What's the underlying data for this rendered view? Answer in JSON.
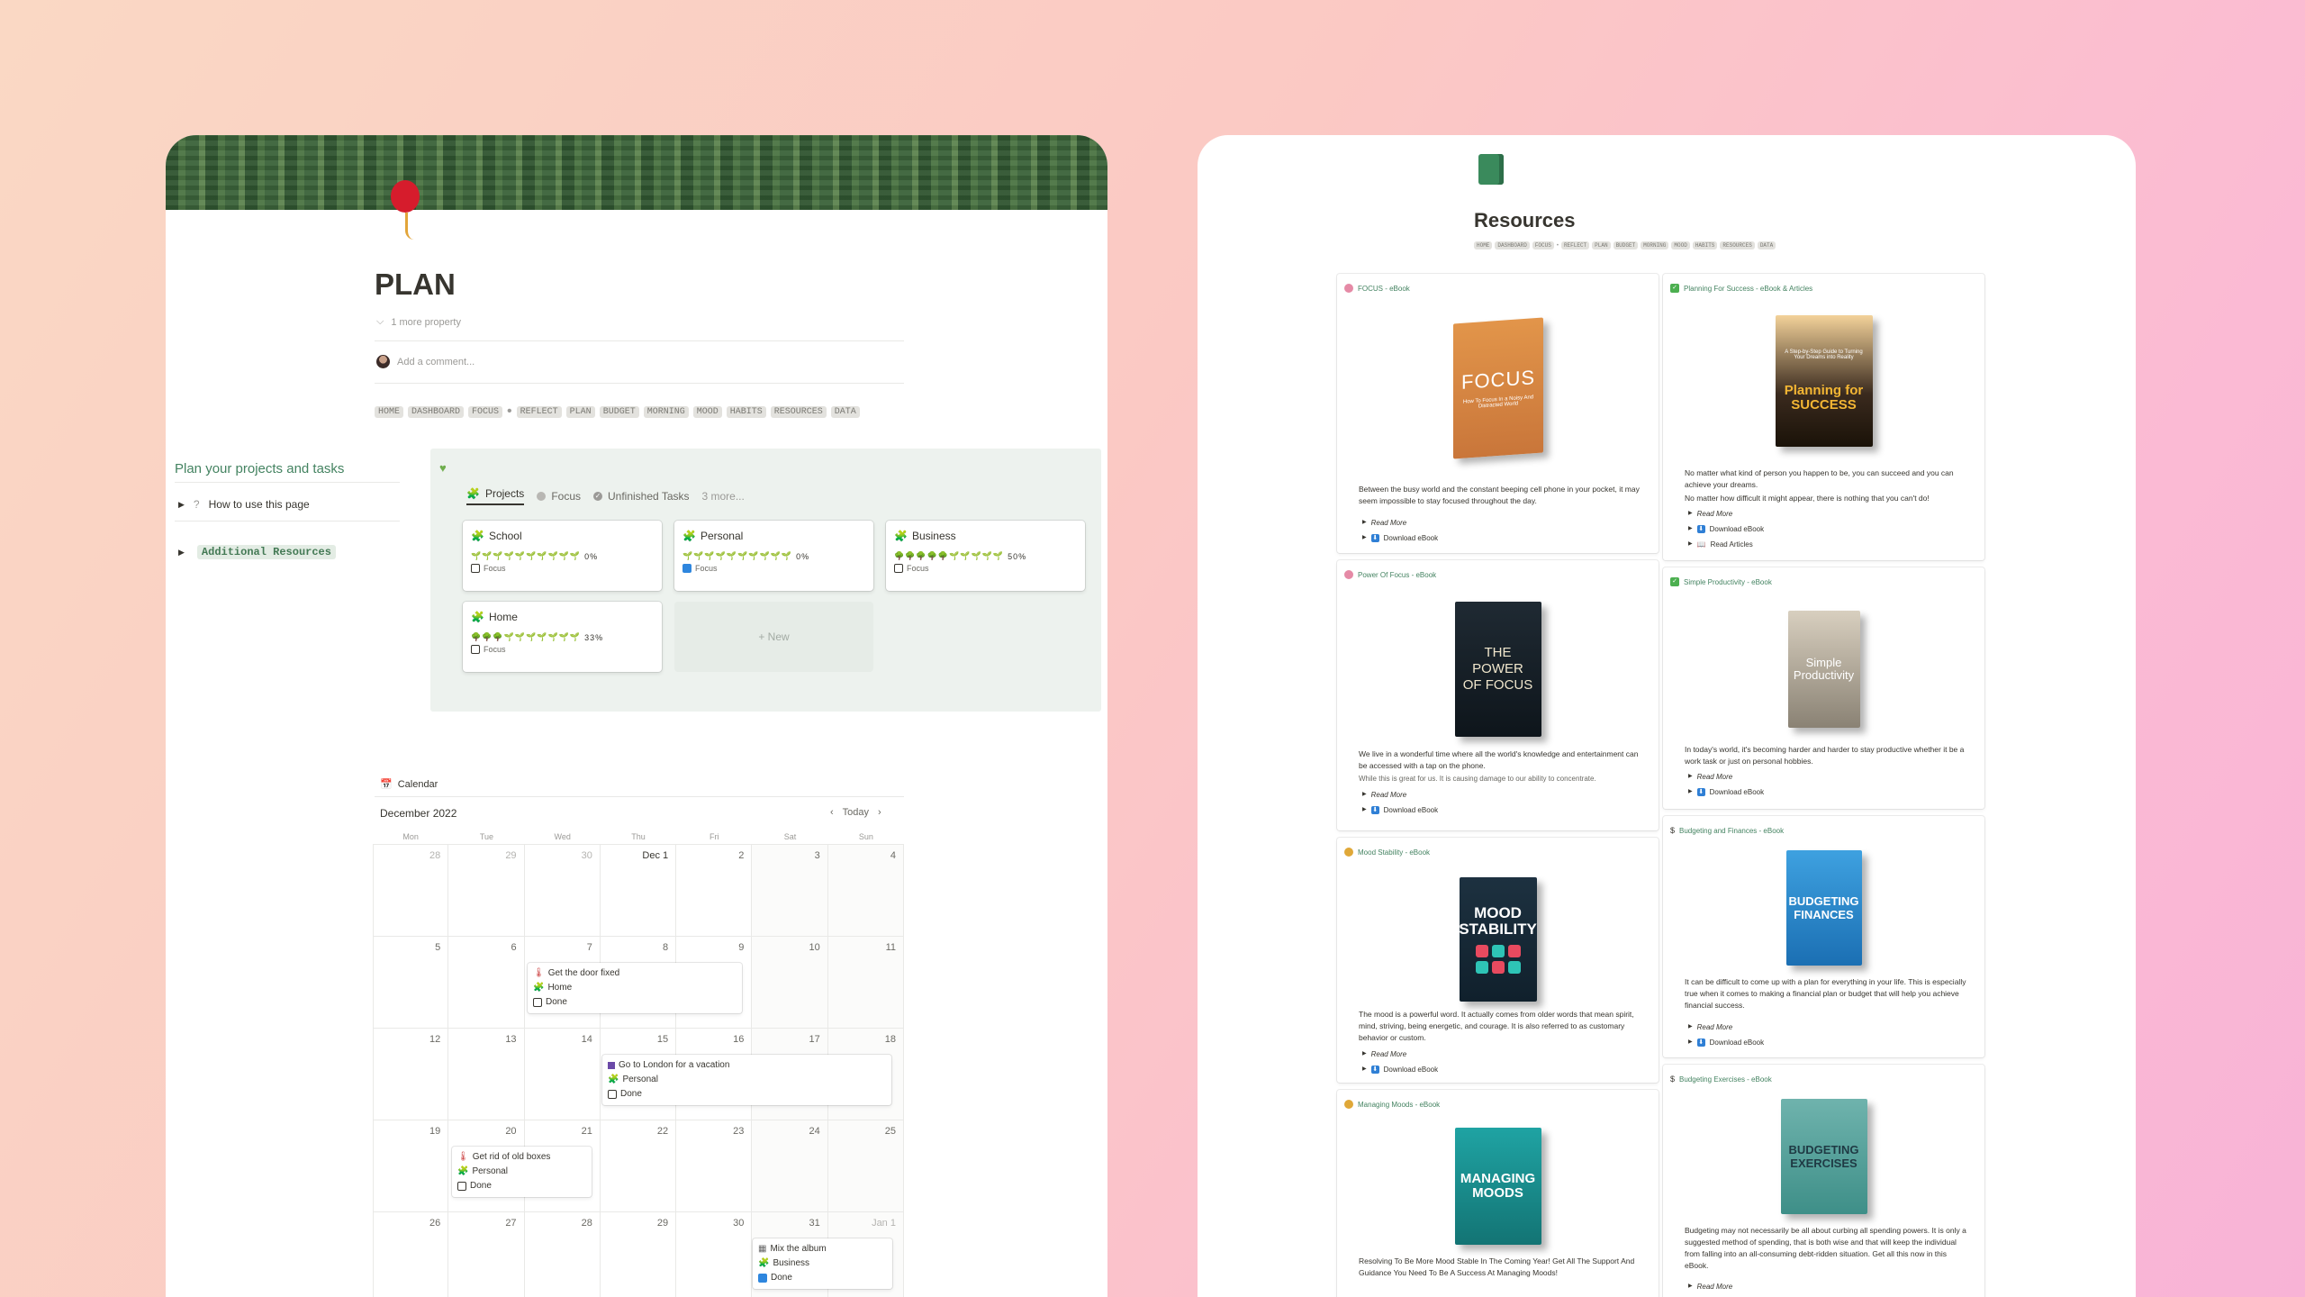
{
  "plan": {
    "title": "PLAN",
    "more_property": "1 more property",
    "comment_placeholder": "Add a comment...",
    "nav": [
      "HOME",
      "DASHBOARD",
      "FOCUS",
      "REFLECT",
      "PLAN",
      "BUDGET",
      "MORNING",
      "MOOD",
      "HABITS",
      "RESOURCES",
      "DATA"
    ],
    "side_heading": "Plan your projects and tasks",
    "how_to": "How to use this page",
    "additional": "Additional Resources",
    "tabs": [
      "Projects",
      "Focus",
      "Unfinished Tasks",
      "3 more..."
    ],
    "projects": [
      {
        "name": "School",
        "bar": "🌱🌱🌱🌱🌱🌱🌱🌱🌱🌱",
        "pct": "0%",
        "focus": false
      },
      {
        "name": "Personal",
        "bar": "🌱🌱🌱🌱🌱🌱🌱🌱🌱🌱",
        "pct": "0%",
        "focus": true
      },
      {
        "name": "Business",
        "bar": "🌳🌳🌳🌳🌳🌱🌱🌱🌱🌱",
        "pct": "50%",
        "focus": false
      },
      {
        "name": "Home",
        "bar": "🌳🌳🌳🌱🌱🌱🌱🌱🌱🌱",
        "pct": "33%",
        "focus": false
      }
    ],
    "focus_label": "Focus",
    "new_label": "+ New",
    "calendar": {
      "view": "Calendar",
      "month": "December 2022",
      "today": "Today",
      "days": [
        "Mon",
        "Tue",
        "Wed",
        "Thu",
        "Fri",
        "Sat",
        "Sun"
      ],
      "dates": [
        "28",
        "29",
        "30",
        "Dec 1",
        "2",
        "3",
        "4",
        "5",
        "6",
        "7",
        "8",
        "9",
        "10",
        "11",
        "12",
        "13",
        "14",
        "15",
        "16",
        "17",
        "18",
        "19",
        "20",
        "21",
        "22",
        "23",
        "24",
        "25",
        "26",
        "27",
        "28",
        "29",
        "30",
        "31",
        "Jan 1"
      ],
      "events": [
        {
          "title": "Get the door fixed",
          "project": "Home",
          "status": "Done",
          "done": false
        },
        {
          "title": "Go to London for a vacation",
          "project": "Personal",
          "status": "Done",
          "done": false
        },
        {
          "title": "Get rid of old boxes",
          "project": "Personal",
          "status": "Done",
          "done": false
        },
        {
          "title": "Mix the album",
          "project": "Business",
          "status": "Done",
          "done": true
        }
      ]
    }
  },
  "resources": {
    "title": "Resources",
    "nav": [
      "HOME",
      "DASHBOARD",
      "FOCUS",
      "REFLECT",
      "PLAN",
      "BUDGET",
      "MORNING",
      "MOOD",
      "HABITS",
      "RESOURCES",
      "DATA"
    ],
    "read_more": "Read More",
    "download": "Download eBook",
    "read_articles": "Read Articles",
    "left": [
      {
        "head": "FOCUS - eBook",
        "cover_title": "FOCUS",
        "cover_sub": "How To Focus In a Noisy And Distracted World",
        "desc": "Between the busy world and the constant beeping cell phone in your pocket, it may seem impossible to stay focused throughout the day."
      },
      {
        "head": "Power Of Focus - eBook",
        "cover_title": "THE POWER OF FOCUS",
        "desc": "We live in a wonderful time where all the world's knowledge and entertainment can be accessed with a tap on the phone.",
        "desc2": "While this is great for us. It is causing damage to our ability to concentrate."
      },
      {
        "head": "Mood Stability - eBook",
        "cover_title": "MOOD STABILITY",
        "desc": "The mood is a powerful word. It actually comes from older words that mean spirit, mind, striving, being energetic, and courage. It is also referred to as customary behavior or custom."
      },
      {
        "head": "Managing Moods - eBook",
        "cover_title": "MANAGING MOODS",
        "desc": "Resolving To Be More Mood Stable In The Coming Year! Get All The Support And Guidance You Need To Be A Success At Managing Moods!"
      }
    ],
    "right": [
      {
        "head": "Planning For Success - eBook & Articles",
        "cover_title": "Planning for SUCCESS",
        "cover_sub": "A Step-by-Step Guide to Turning Your Dreams into Reality",
        "desc": "No matter what kind of person you happen to be, you can succeed and you can achieve your dreams.",
        "desc2": "No matter how difficult it might appear, there is nothing that you can't do!"
      },
      {
        "head": "Simple Productivity - eBook",
        "cover_title": "Simple Productivity",
        "desc": "In today's world, it's becoming harder and harder to stay productive whether it be a work task or just on personal hobbies."
      },
      {
        "head": "Budgeting and Finances - eBook",
        "cover_title": "BUDGETING FINANCES",
        "desc": "It can be difficult to come up with a plan for everything in your life. This is especially true when it comes to making a financial plan or budget that will help you achieve financial success."
      },
      {
        "head": "Budgeting Exercises - eBook",
        "cover_title": "BUDGETING EXERCISES",
        "desc": "Budgeting may not necessarily be all about curbing all spending powers. It is only a suggested method of spending, that is both wise and that will keep the individual from falling into an all-consuming debt-ridden situation. Get all this now in this eBook."
      }
    ]
  },
  "colors": {
    "accent_green": "#448361",
    "gallery_bg": "#edf2ee",
    "checkbox_blue": "#2e86de",
    "balloon": "#d61c2c"
  },
  "icons": [
    "balloon-icon",
    "chevron-down-icon",
    "avatar",
    "heart-icon",
    "puzzle-icon",
    "circle-icon",
    "check-circle-icon",
    "calendar-icon",
    "book-icon",
    "dollar-icon",
    "checkbox-icon"
  ]
}
